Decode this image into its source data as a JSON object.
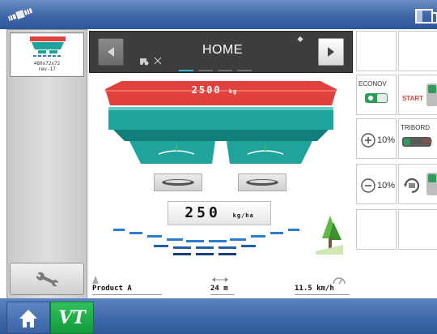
{
  "thumbnail": {
    "size_label": "480x72x72",
    "revision_label": "rev-17"
  },
  "nav": {
    "title": "HOME"
  },
  "hopper": {
    "weight_value": "2500",
    "weight_unit": "kg"
  },
  "rate": {
    "value": "250",
    "unit": "kg/ha"
  },
  "info": {
    "product": "Product A",
    "width": "24 m",
    "speed": "11.5 km/h"
  },
  "grid": {
    "econov_label": "ECONOV",
    "start_label": "START",
    "tribord_label": "TRIBORD",
    "eco_label": "eco",
    "pct_top": "10%",
    "pct_bottom": "10%"
  },
  "taskbar": {
    "vt_label": "VT"
  },
  "colors": {
    "topbar_blue": "#3f67a8",
    "hopper_red": "#e0413d",
    "hopper_teal": "#1fa39d",
    "spread_blue": "#2a7ed0",
    "vt_green": "#1fae4a"
  },
  "icons": {
    "satellite": "satellite-icon",
    "window": "window-icon",
    "wrench": "wrench-icon",
    "home": "home-icon",
    "tree": "tree-icon",
    "prev": "arrow-left-icon",
    "next": "arrow-right-icon"
  }
}
